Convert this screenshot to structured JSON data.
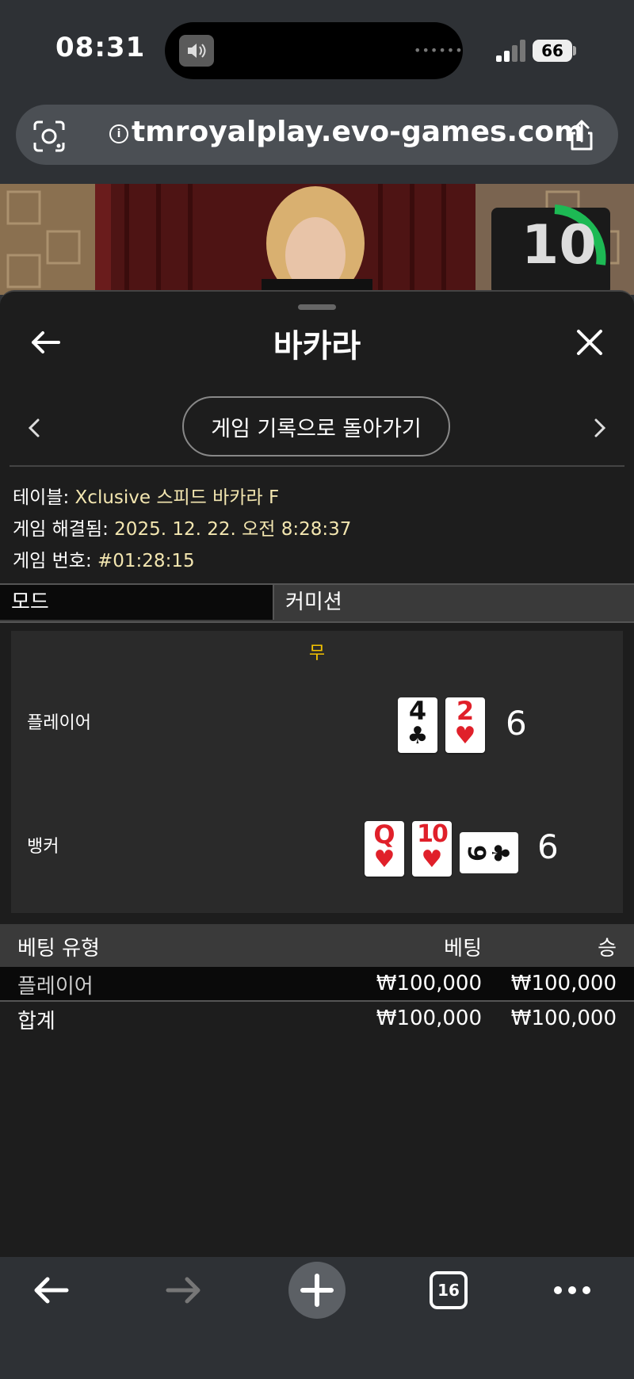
{
  "status_bar": {
    "time": "08:31",
    "island_dots": "••••••",
    "battery": "66"
  },
  "browser": {
    "url": "tmroyalplay.evo-games.com"
  },
  "video": {
    "timer": "10"
  },
  "panel": {
    "title": "바카라",
    "back_to_history": "게임 기록으로 돌아가기",
    "info": {
      "table_label": "테이블: ",
      "table_value": "Xclusive 스피드 바카라 F",
      "resolved_label": "게임 해결됨: ",
      "resolved_value": "2025. 12. 22. 오전 8:28:37",
      "number_label": "게임 번호: ",
      "number_value": "#01:28:15"
    },
    "mode": {
      "mode_label": "모드",
      "mode_value": "커미션"
    },
    "result": {
      "outcome": "무",
      "player_label": "플레이어",
      "player_score": "6",
      "banker_label": "뱅커",
      "banker_score": "6",
      "player_cards": [
        {
          "rank": "4",
          "suit": "♣"
        },
        {
          "rank": "2",
          "suit": "♥"
        }
      ],
      "banker_cards": [
        {
          "rank": "Q",
          "suit": "♥"
        },
        {
          "rank": "10",
          "suit": "♥"
        },
        {
          "rank": "9",
          "suit": "♣"
        }
      ]
    },
    "bets": {
      "headers": {
        "type": "베팅 유형",
        "bet": "베팅",
        "win": "승"
      },
      "rows": [
        {
          "type": "플레이어",
          "bet": "₩100,000",
          "win": "₩100,000"
        }
      ],
      "total": {
        "label": "합계",
        "bet": "₩100,000",
        "win": "₩100,000"
      }
    }
  },
  "bottom_bar": {
    "tabs_count": "16"
  },
  "colors": {
    "accent_value": "#f3e6b0",
    "outcome": "#f5c400",
    "red_suit": "#e0202a",
    "timer_green": "#1db954"
  }
}
